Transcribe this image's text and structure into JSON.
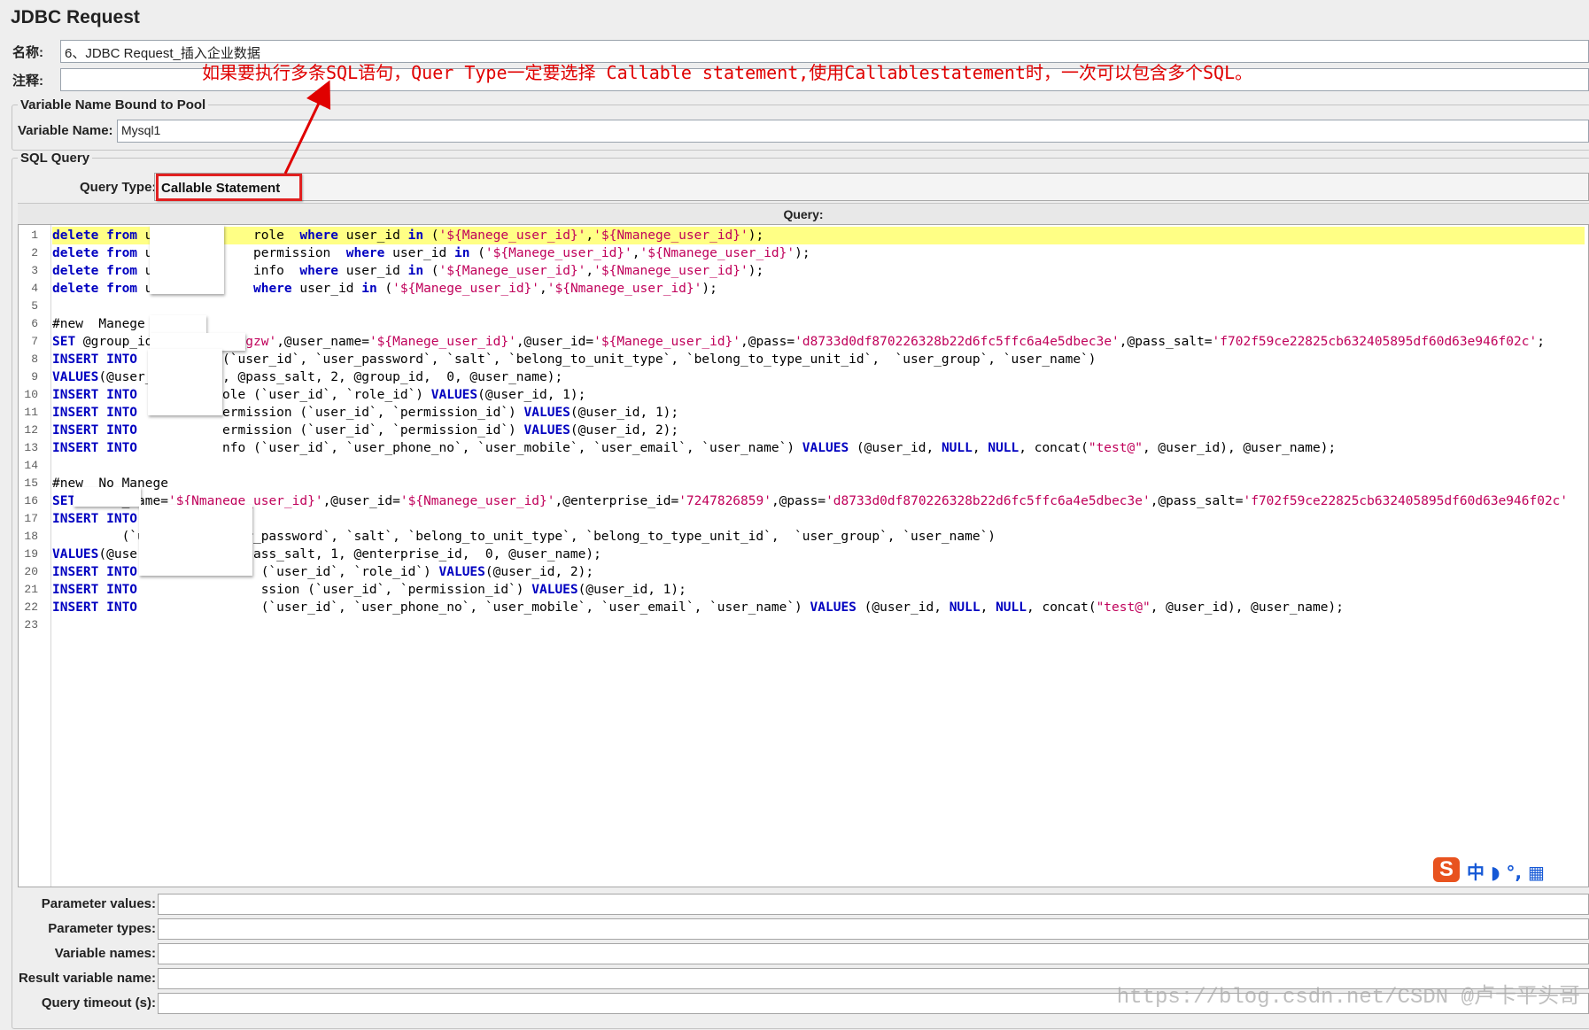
{
  "panel": {
    "title": "JDBC Request"
  },
  "name_field": {
    "label": "名称:",
    "value": "6、JDBC Request_插入企业数据"
  },
  "comment_field": {
    "label": "注释:",
    "value": ""
  },
  "annotation": {
    "text": "如果要执行多条SQL语句，Quer Type一定要选择 Callable statement,使用Callablestatement时，一次可以包含多个SQL。",
    "color": "#e00000"
  },
  "pool_group": {
    "title": "Variable Name Bound to Pool",
    "variable_name_label": "Variable Name:",
    "variable_name_value": "Mysql1"
  },
  "sql_group": {
    "title": "SQL Query",
    "query_type_label": "Query Type:",
    "query_type_value": "Callable Statement",
    "query_header": "Query:"
  },
  "editor": {
    "highlight_color": "#ffff85",
    "lines": [
      {
        "n": "1",
        "html": "<span class=\"kw\">delete from</span> u             role  <span class=\"kw\">where</span> user_id <span class=\"kw\">in</span> (<span class=\"str\">'${Manege_user_id}'</span>,<span class=\"str\">'${Nmanege_user_id}'</span>);"
      },
      {
        "n": "2",
        "html": "<span class=\"kw\">delete from</span> u             permission  <span class=\"kw\">where</span> user_id <span class=\"kw\">in</span> (<span class=\"str\">'${Manege_user_id}'</span>,<span class=\"str\">'${Nmanege_user_id}'</span>);"
      },
      {
        "n": "3",
        "html": "<span class=\"kw\">delete from</span> u             info  <span class=\"kw\">where</span> user_id <span class=\"kw\">in</span> (<span class=\"str\">'${Manege_user_id}'</span>,<span class=\"str\">'${Nmanege_user_id}'</span>);"
      },
      {
        "n": "4",
        "html": "<span class=\"kw\">delete from</span> u             <span class=\"kw\">where</span> user_id <span class=\"kw\">in</span> (<span class=\"str\">'${Manege_user_id}'</span>,<span class=\"str\">'${Nmanege_user_id}'</span>);"
      },
      {
        "n": "5",
        "html": ""
      },
      {
        "n": "6",
        "html": "#new  Manege"
      },
      {
        "n": "7",
        "html": "<span class=\"kw\">SET</span> @group_id=<span class=\"str\">'guangdong_gzw'</span>,@user_name=<span class=\"str\">'${Manege_user_id}'</span>,@user_id=<span class=\"str\">'${Manege_user_id}'</span>,@pass=<span class=\"str\">'d8733d0df870226328b22d6fc5ffc6a4e5dbec3e'</span>,@pass_salt=<span class=\"str\">'f702f59ce22825cb632405895df60d63e946f02c'</span>;"
      },
      {
        "n": "8",
        "html": "<span class=\"kw\">INSERT INTO</span>           (`user_id`, `user_password`, `salt`, `belong_to_unit_type`, `belong_to_type_unit_id`,  `user_group`, `user_name`)"
      },
      {
        "n": "9",
        "html": "<span class=\"kw\">VALUES</span>(@user_id, @pass, @pass_salt, 2, @group_id,  0, @user_name);"
      },
      {
        "n": "10",
        "html": "<span class=\"kw\">INSERT INTO</span>           ole (`user_id`, `role_id`) <span class=\"kw\">VALUES</span>(@user_id, 1);"
      },
      {
        "n": "11",
        "html": "<span class=\"kw\">INSERT INTO</span>           ermission (`user_id`, `permission_id`) <span class=\"kw\">VALUES</span>(@user_id, 1);"
      },
      {
        "n": "12",
        "html": "<span class=\"kw\">INSERT INTO</span>           ermission (`user_id`, `permission_id`) <span class=\"kw\">VALUES</span>(@user_id, 2);"
      },
      {
        "n": "13",
        "html": "<span class=\"kw\">INSERT INTO</span>           nfo (`user_id`, `user_phone_no`, `user_mobile`, `user_email`, `user_name`) <span class=\"kw\">VALUES</span> (@user_id, <span class=\"kw\">NULL</span>, <span class=\"kw\">NULL</span>, concat(<span class=\"str\">\"test@\"</span>, @user_id), @user_name);"
      },
      {
        "n": "14",
        "html": ""
      },
      {
        "n": "15",
        "html": "#new  No Manege"
      },
      {
        "n": "16",
        "html": "<span class=\"kw\">SET</span> @user_name=<span class=\"str\">'${Nmanege_user_id}'</span>,@user_id=<span class=\"str\">'${Nmanege_user_id}'</span>,@enterprise_id=<span class=\"str\">'7247826859'</span>,@pass=<span class=\"str\">'d8733d0df870226328b22d6fc5ffc6a4e5dbec3e'</span>,@pass_salt=<span class=\"str\">'f702f59ce22825cb632405895df60d63e946f02c'</span>"
      },
      {
        "n": "17",
        "html": "<span class=\"kw\">INSERT INTO</span>"
      },
      {
        "n": "18",
        "html": "         (`user_id`, `user_password`, `salt`, `belong_to_unit_type`, `belong_to_type_unit_id`,  `user_group`, `user_name`)"
      },
      {
        "n": "19",
        "html": "<span class=\"kw\">VALUES</span>(@user_id, @pass, @pass_salt, 1, @enterprise_id,  0, @user_name);"
      },
      {
        "n": "20",
        "html": "<span class=\"kw\">INSERT INTO</span>                (`user_id`, `role_id`) <span class=\"kw\">VALUES</span>(@user_id, 2);"
      },
      {
        "n": "21",
        "html": "<span class=\"kw\">INSERT INTO</span>                ssion (`user_id`, `permission_id`) <span class=\"kw\">VALUES</span>(@user_id, 1);"
      },
      {
        "n": "22",
        "html": "<span class=\"kw\">INSERT INTO</span>                (`user_id`, `user_phone_no`, `user_mobile`, `user_email`, `user_name`) <span class=\"kw\">VALUES</span> (@user_id, <span class=\"kw\">NULL</span>, <span class=\"kw\">NULL</span>, concat(<span class=\"str\">\"test@\"</span>, @user_id), @user_name);"
      },
      {
        "n": "23",
        "html": ""
      }
    ]
  },
  "ime": {
    "logo": "S",
    "text": "中 ◗ °, ▦"
  },
  "params": [
    {
      "label": "Parameter values:",
      "value": ""
    },
    {
      "label": "Parameter types:",
      "value": ""
    },
    {
      "label": "Variable names:",
      "value": ""
    },
    {
      "label": "Result variable name:",
      "value": ""
    },
    {
      "label": "Query timeout (s):",
      "value": ""
    }
  ],
  "watermark": {
    "text": "https://blog.csdn.net/CSDN @卢卡平头哥"
  }
}
